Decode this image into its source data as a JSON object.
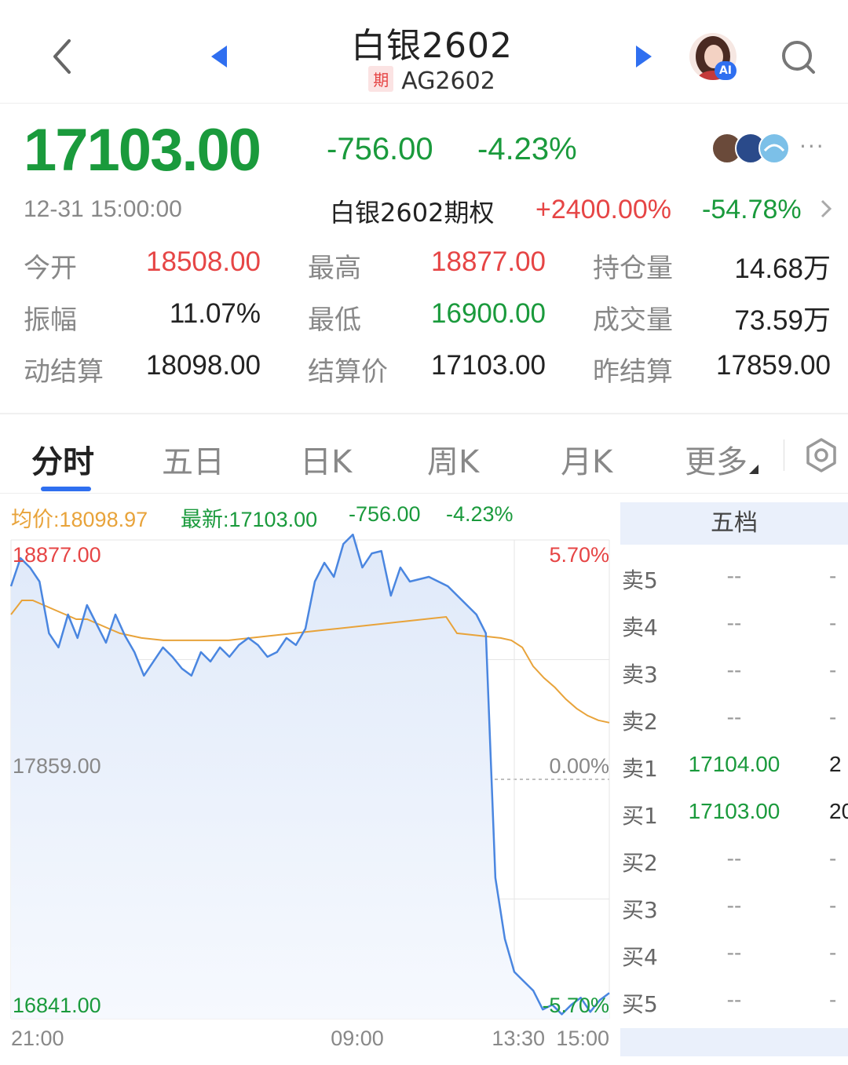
{
  "header": {
    "title": "白银2602",
    "badge": "期",
    "code": "AG2602",
    "ai_badge": "AI"
  },
  "quote": {
    "price": "17103.00",
    "change": "-756.00",
    "change_pct": "-4.23%",
    "time": "12-31 15:00:00",
    "more": "···",
    "option": {
      "label": "白银2602期权",
      "up": "+2400.00%",
      "down": "-54.78%"
    }
  },
  "stats": [
    {
      "label": "今开",
      "value": "18508.00",
      "color": "red"
    },
    {
      "label": "最高",
      "value": "18877.00",
      "color": "red"
    },
    {
      "label": "持仓量",
      "value": "14.68万",
      "color": "black"
    },
    {
      "label": "振幅",
      "value": "11.07%",
      "color": "black"
    },
    {
      "label": "最低",
      "value": "16900.00",
      "color": "green"
    },
    {
      "label": "成交量",
      "value": "73.59万",
      "color": "black"
    },
    {
      "label": "动结算",
      "value": "18098.00",
      "color": "black"
    },
    {
      "label": "结算价",
      "value": "17103.00",
      "color": "black"
    },
    {
      "label": "昨结算",
      "value": "17859.00",
      "color": "black"
    }
  ],
  "tabs": [
    "分时",
    "五日",
    "日K",
    "周K",
    "月K",
    "更多"
  ],
  "legend": {
    "avg": "均价:18098.97",
    "latest": "最新:17103.00",
    "change": "-756.00",
    "change_pct": "-4.23%"
  },
  "chart_data": {
    "type": "line",
    "y_labels": {
      "top": "18877.00",
      "mid": "17859.00",
      "bottom": "16841.00"
    },
    "pct_labels": {
      "top": "5.70%",
      "mid": "0.00%",
      "bottom": "-5.70%"
    },
    "x_labels": [
      "21:00",
      "09:00",
      "13:30",
      "15:00"
    ],
    "ylim": [
      16841,
      18877
    ],
    "baseline": 17859,
    "series": [
      {
        "name": "最新",
        "color": "#4a86e0",
        "values": [
          18680,
          18800,
          18760,
          18700,
          18480,
          18420,
          18560,
          18460,
          18600,
          18520,
          18440,
          18560,
          18470,
          18400,
          18300,
          18360,
          18420,
          18380,
          18330,
          18300,
          18400,
          18360,
          18420,
          18380,
          18430,
          18460,
          18430,
          18380,
          18400,
          18460,
          18430,
          18500,
          18700,
          18780,
          18720,
          18860,
          18900,
          18760,
          18820,
          18830,
          18640,
          18760,
          18700,
          18710,
          18720,
          18700,
          18680,
          18640,
          18600,
          18560,
          18480,
          17440,
          17180,
          17040,
          17000,
          16960,
          16880,
          16900,
          16860,
          16900,
          16930,
          16870,
          16920,
          16950
        ]
      },
      {
        "name": "均价",
        "color": "#e8a33a",
        "values": [
          18560,
          18620,
          18620,
          18600,
          18580,
          18560,
          18540,
          18540,
          18520,
          18500,
          18480,
          18470,
          18460,
          18455,
          18450,
          18450,
          18450,
          18450,
          18450,
          18450,
          18450,
          18455,
          18460,
          18465,
          18470,
          18475,
          18480,
          18485,
          18490,
          18495,
          18500,
          18505,
          18510,
          18515,
          18520,
          18525,
          18530,
          18535,
          18540,
          18545,
          18550,
          18480,
          18475,
          18470,
          18465,
          18460,
          18450,
          18420,
          18340,
          18290,
          18250,
          18200,
          18160,
          18130,
          18110,
          18100
        ]
      }
    ]
  },
  "order_book": {
    "title": "五档",
    "rows": [
      {
        "label": "卖5",
        "price": "--",
        "vol": "-"
      },
      {
        "label": "卖4",
        "price": "--",
        "vol": "-"
      },
      {
        "label": "卖3",
        "price": "--",
        "vol": "-"
      },
      {
        "label": "卖2",
        "price": "--",
        "vol": "-"
      },
      {
        "label": "卖1",
        "price": "17104.00",
        "vol": "2"
      },
      {
        "label": "买1",
        "price": "17103.00",
        "vol": "20"
      },
      {
        "label": "买2",
        "price": "--",
        "vol": "-"
      },
      {
        "label": "买3",
        "price": "--",
        "vol": "-"
      },
      {
        "label": "买4",
        "price": "--",
        "vol": "-"
      },
      {
        "label": "买5",
        "price": "--",
        "vol": "-"
      }
    ]
  },
  "colors": {
    "up": "#e64545",
    "down": "#1a9a3c",
    "accent": "#2f6ff0",
    "avg_line": "#e8a33a",
    "price_line": "#4a86e0"
  }
}
